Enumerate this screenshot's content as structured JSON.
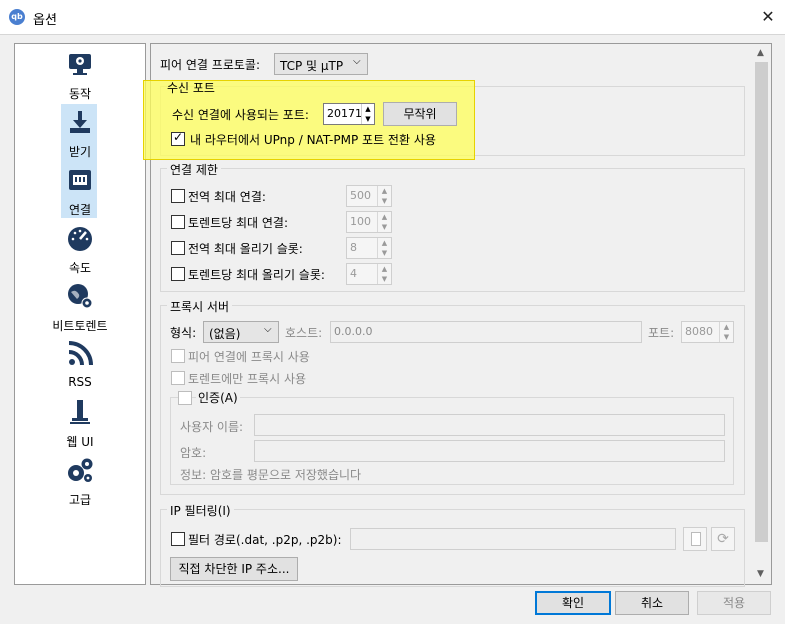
{
  "window": {
    "title": "옵션",
    "app_icon_text": "qb"
  },
  "nav": [
    {
      "label": "동작",
      "icon": "monitor-gear-icon"
    },
    {
      "label": "받기",
      "icon": "download-icon"
    },
    {
      "label": "연결",
      "icon": "network-icon"
    },
    {
      "label": "속도",
      "icon": "speedometer-icon"
    },
    {
      "label": "비트토렌트",
      "icon": "globe-gear-icon"
    },
    {
      "label": "RSS",
      "icon": "rss-icon"
    },
    {
      "label": "웹 UI",
      "icon": "web-ui-icon"
    },
    {
      "label": "고급",
      "icon": "gears-icon"
    }
  ],
  "selected_nav": "연결",
  "protocol": {
    "label": "피어 연결 프로토콜:",
    "value": "TCP 및 µTP"
  },
  "listen_port": {
    "title": "수신 포트",
    "port_label": "수신 연결에 사용되는 포트:",
    "port_value": "20171",
    "random_button": "무작위",
    "upnp_label": "내 라우터에서 UPnp / NAT-PMP 포트 전환 사용",
    "upnp_checked": true
  },
  "connection_limits": {
    "title": "연결 제한",
    "rows": [
      {
        "label": "전역 최대 연결:",
        "value": "500"
      },
      {
        "label": "토렌트당 최대 연결:",
        "value": "100"
      },
      {
        "label": "전역 최대 올리기 슬롯:",
        "value": "8"
      },
      {
        "label": "토렌트당 최대 올리기 슬롯:",
        "value": "4"
      }
    ]
  },
  "proxy": {
    "title": "프록시 서버",
    "type_label": "형식:",
    "type_value": "(없음)",
    "host_label": "호스트:",
    "host_value": "0.0.0.0",
    "port_label": "포트:",
    "port_value": "8080",
    "peer_proxy_label": "피어 연결에 프록시 사용",
    "torrent_only_label": "토렌트에만 프록시 사용",
    "auth_title": "인증(A)",
    "username_label": "사용자 이름:",
    "password_label": "암호:",
    "info_text": "정보: 암호를 평문으로 저장했습니다"
  },
  "ip_filter": {
    "title": "IP 필터링(I)",
    "path_label": "필터 경로(.dat, .p2p, .p2b):",
    "banned_button": "직접 차단한 IP 주소..."
  },
  "buttons": {
    "ok": "확인",
    "cancel": "취소",
    "apply": "적용"
  },
  "colors": {
    "highlight": "#ffff5a",
    "selection": "#cce4f7",
    "icon": "#1f3a5f"
  }
}
